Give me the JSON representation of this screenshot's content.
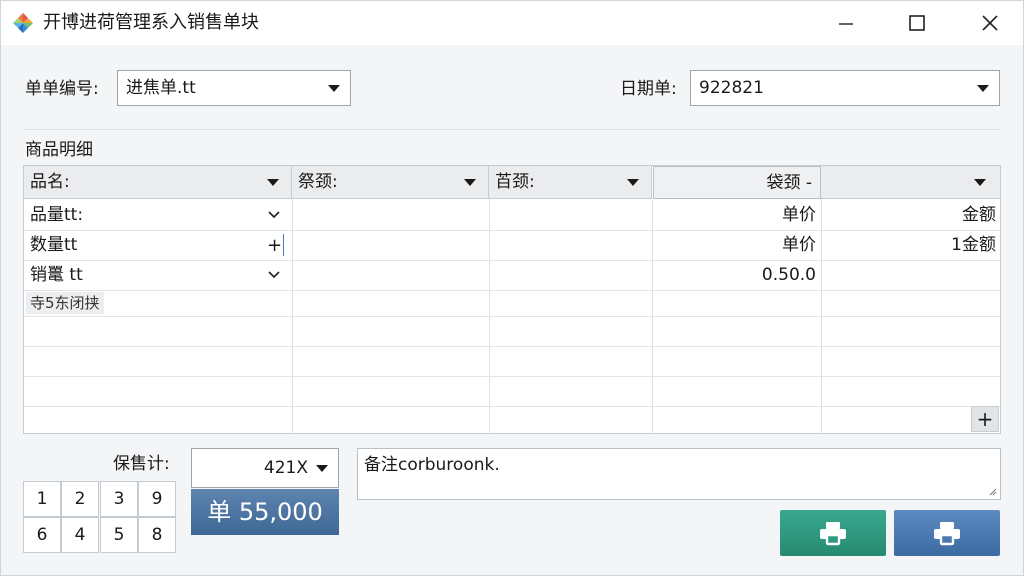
{
  "window": {
    "title": "开博进荷管理系入销售单块",
    "controls": [
      "minimize-icon",
      "maximize-icon",
      "close-icon"
    ]
  },
  "header": {
    "order_no_label": "单单编号:",
    "order_no_value": "进焦单.tt",
    "date_label": "日期单:",
    "date_value": "922821"
  },
  "details": {
    "section_title": "商品明细",
    "columns": [
      "品名:",
      "祭颈:",
      "苩颈:",
      "袋颈 -",
      ""
    ],
    "rows": [
      {
        "c1": "品量tt:",
        "c4": "单价",
        "c5": "金额"
      },
      {
        "c1": "数量tt",
        "c4": "单价",
        "c5": "1金额"
      },
      {
        "c1": "销鼍 tt",
        "c4": "0.50.0",
        "c5": ""
      }
    ],
    "tag": "寺5东闭挟",
    "add_row_symbol": "+"
  },
  "footer": {
    "total_label": "保售计:",
    "total_select": "421X",
    "total_amount": "单 55,000",
    "keypad": [
      "1",
      "2",
      "3",
      "9",
      "6",
      "4",
      "5",
      "8"
    ],
    "notes": "备注corburoonk."
  },
  "buttons": {
    "print_green_icon": "printer-icon",
    "print_blue_icon": "printer-icon"
  },
  "colors": {
    "accent_blue": "#3f6895",
    "accent_green": "#268a71",
    "panel_bg": "#f3f5f7"
  }
}
